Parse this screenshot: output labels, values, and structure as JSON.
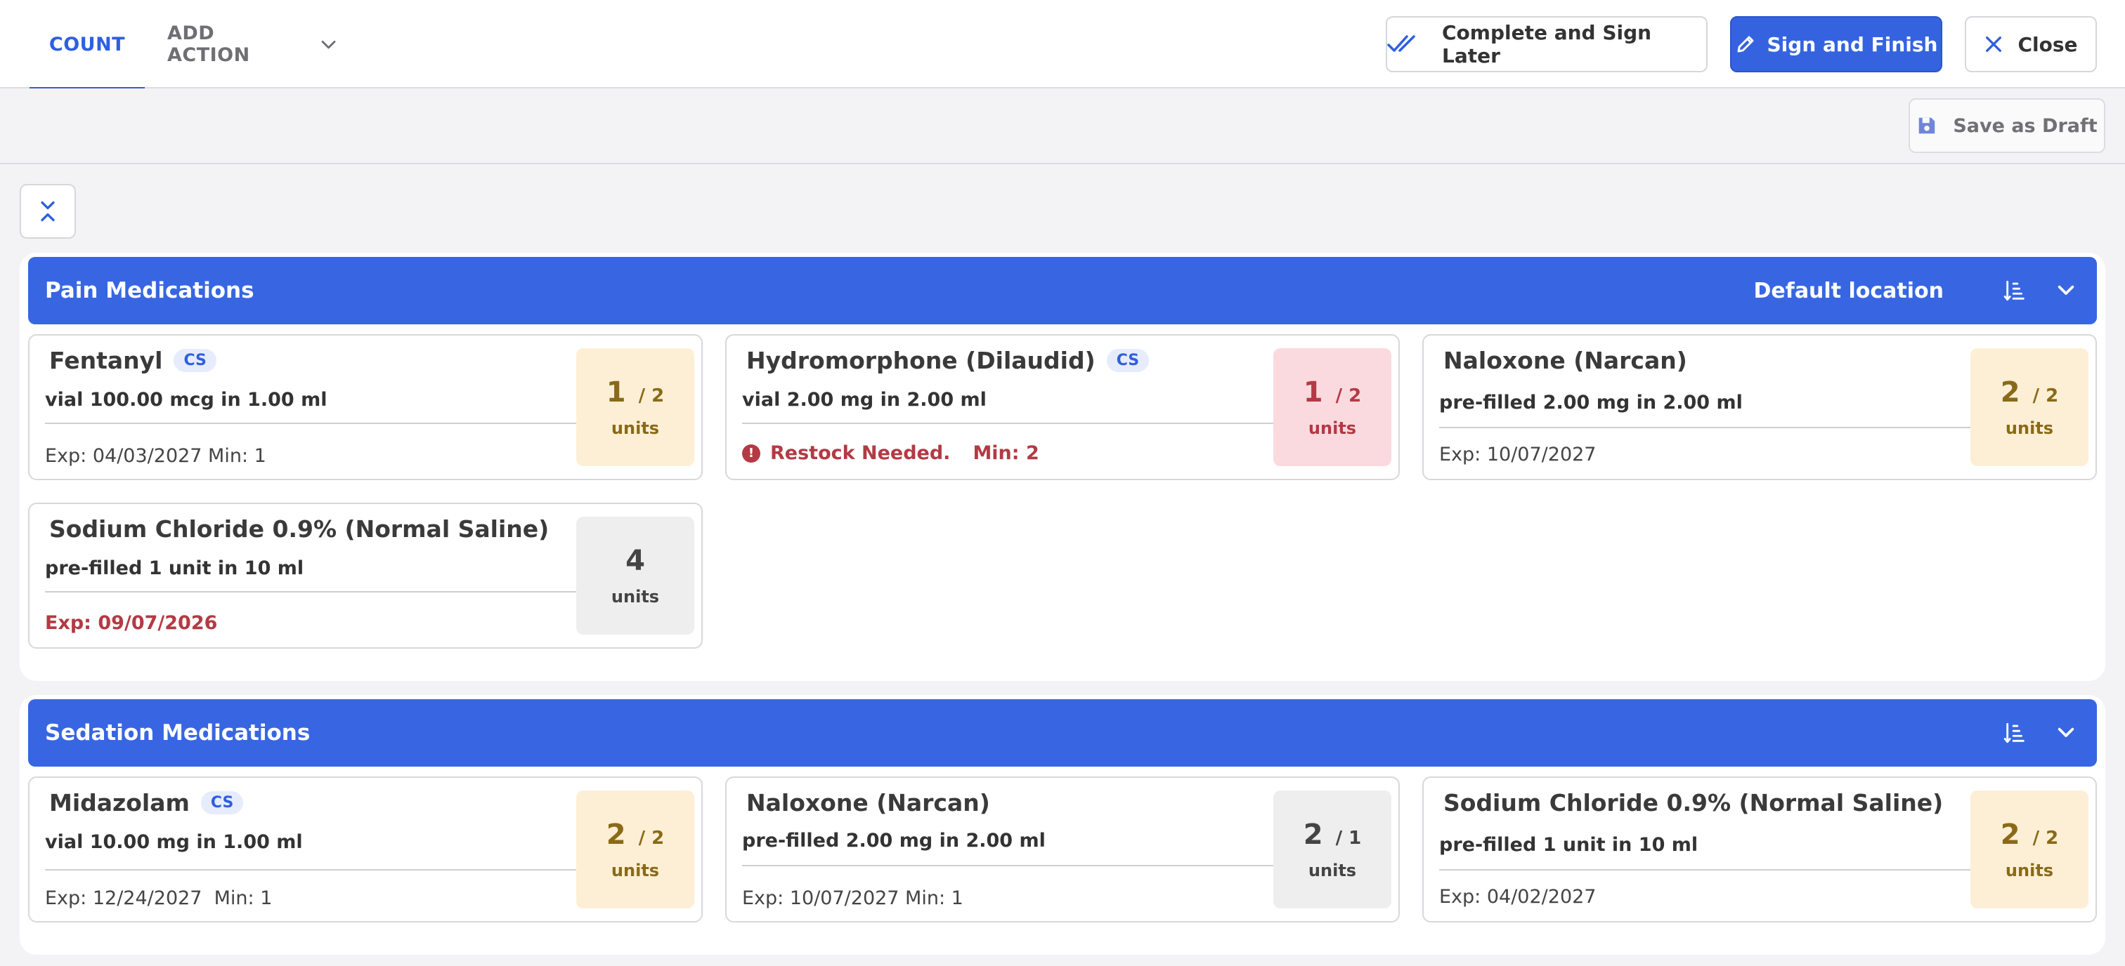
{
  "tabs": {
    "count": "COUNT",
    "add_action": "ADD ACTION"
  },
  "actions": {
    "complete_later": "Complete and Sign Later",
    "sign_finish": "Sign and Finish",
    "close": "Close",
    "save_draft": "Save as Draft"
  },
  "colors": {
    "accent": "#3563e0",
    "warning_bg": "#fdefd5",
    "danger_bg": "#fadadf",
    "neutral_bg": "#eeeeef",
    "danger_text": "#b33a44"
  },
  "sections": [
    {
      "title": "Pain Medications",
      "location": "Default location",
      "cards": [
        {
          "name": "Fentanyl",
          "badge": "CS",
          "sub": "vial 100.00 mcg in 1.00 ml",
          "footer": "Exp: 04/03/2027 Min: 1",
          "count": "1",
          "max": "/ 2",
          "unit": "units",
          "status": "ok"
        },
        {
          "name": "Hydromorphone (Dilaudid)",
          "badge": "CS",
          "sub": "vial 2.00 mg in 2.00 ml",
          "footer": "Restock Needed.",
          "footer_extra": "Min: 2",
          "count": "1",
          "max": "/ 2",
          "unit": "units",
          "status": "low"
        },
        {
          "name": "Naloxone (Narcan)",
          "sub": "pre-filled 2.00 mg in 2.00 ml",
          "footer": "Exp: 10/07/2027",
          "count": "2",
          "max": "/ 2",
          "unit": "units",
          "status": "ok"
        },
        {
          "name": "Sodium Chloride 0.9% (Normal Saline)",
          "sub": "pre-filled 1 unit in 10 ml",
          "footer": "Exp: 09/07/2026",
          "count": "4",
          "unit": "units",
          "status": "full"
        }
      ]
    },
    {
      "title": "Sedation Medications",
      "cards": [
        {
          "name": "Midazolam",
          "badge": "CS",
          "sub": "vial 10.00 mg in 1.00 ml",
          "footer": "Exp: 12/24/2027  Min: 1",
          "count": "2",
          "max": "/ 2",
          "unit": "units",
          "status": "ok"
        },
        {
          "name": "Naloxone (Narcan)",
          "sub": "pre-filled 2.00 mg in 2.00 ml",
          "footer": "Exp: 10/07/2027 Min: 1",
          "count": "2",
          "max": "/ 1",
          "unit": "units",
          "status": "full"
        },
        {
          "name": "Sodium Chloride 0.9% (Normal Saline)",
          "sub": "pre-filled 1 unit in 10 ml",
          "footer": "Exp: 04/02/2027",
          "count": "2",
          "max": "/ 2",
          "unit": "units",
          "status": "ok"
        }
      ]
    }
  ]
}
